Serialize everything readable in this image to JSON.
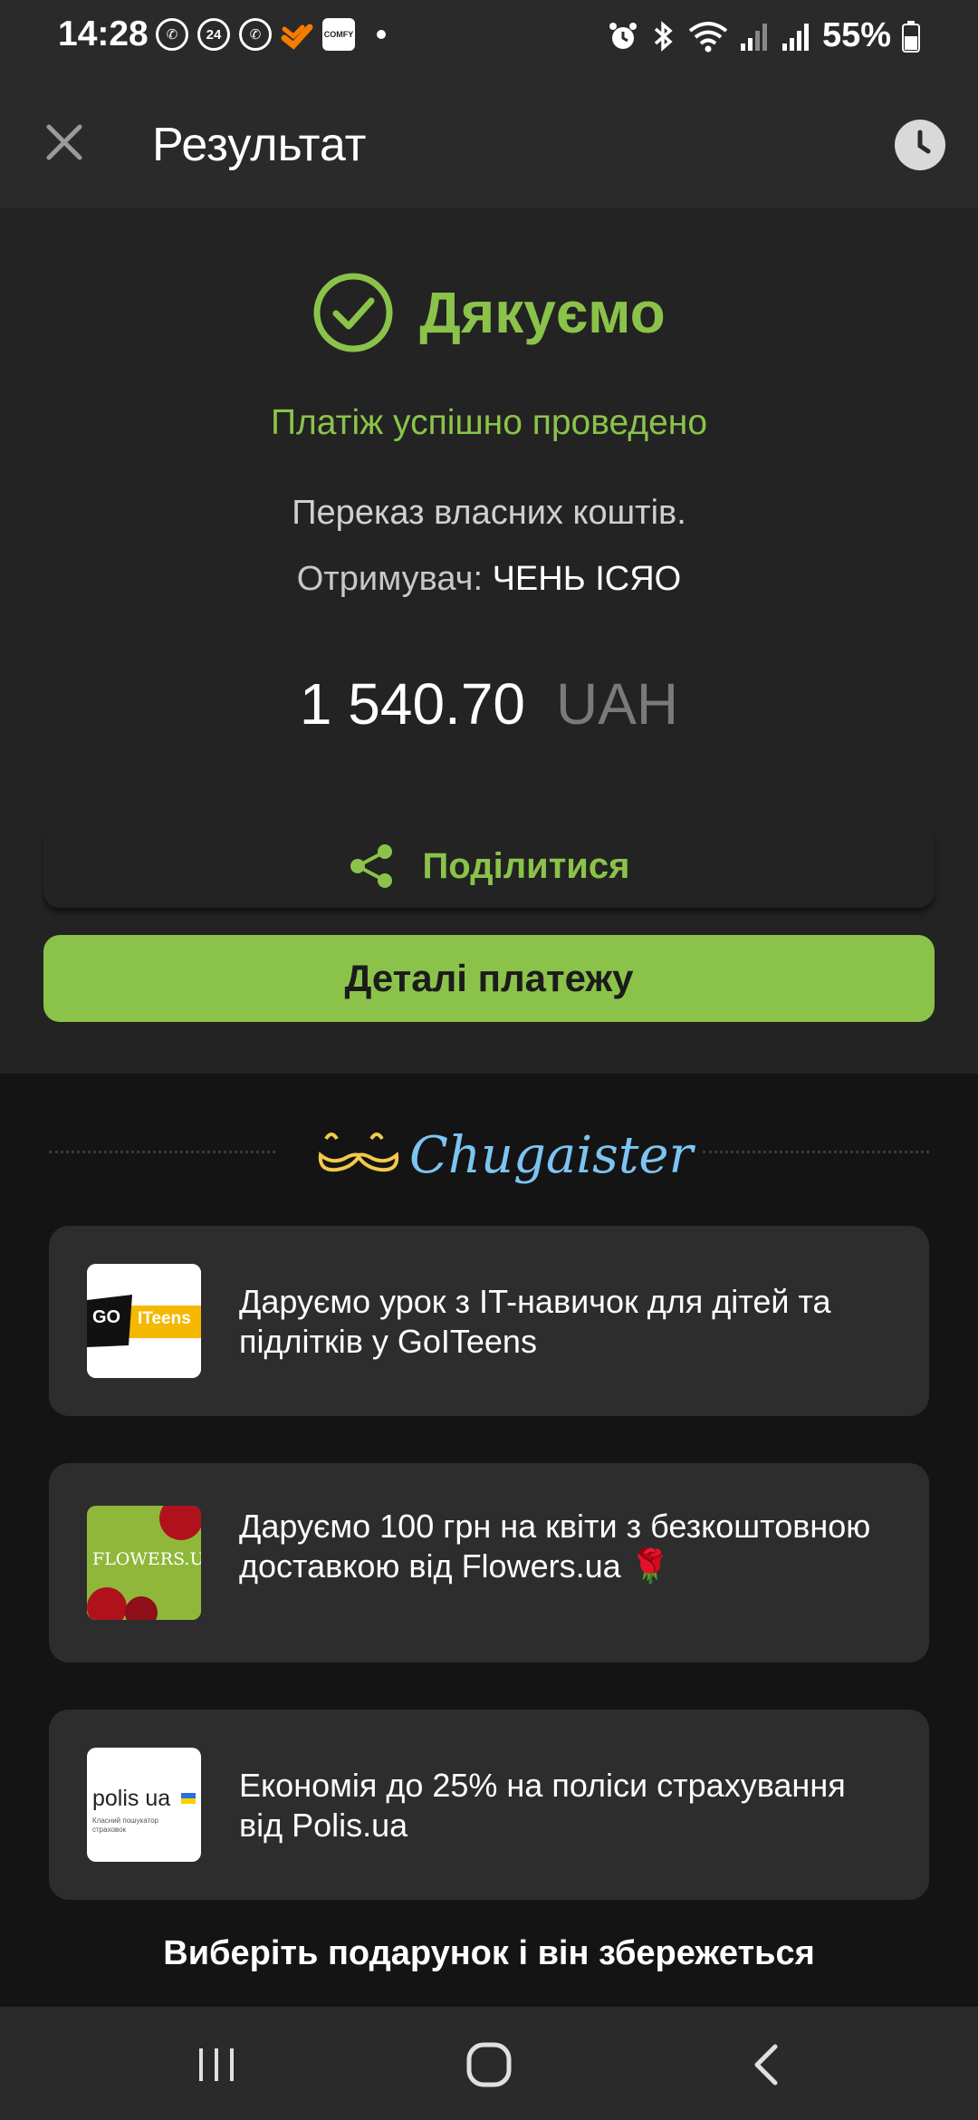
{
  "status_bar": {
    "time": "14:28",
    "left_icons": [
      "viber-icon",
      "notification-24-icon",
      "viber-icon",
      "app-icon",
      "comfy-icon"
    ],
    "comfy_label": "COMFY",
    "badge_24": "24",
    "battery": "55%"
  },
  "header": {
    "title": "Результат"
  },
  "result": {
    "thanks": "Дякуємо",
    "success": "Платіж успішно проведено",
    "transfer": "Переказ власних коштів.",
    "recipient_label": "Отримувач:",
    "recipient_name": "ЧЕНЬ ІСЯО",
    "amount": "1 540.70",
    "currency": "UAH",
    "share_label": "Поділитися",
    "details_label": "Деталі платежу"
  },
  "promos": {
    "brand": "Chugaister",
    "cards": [
      {
        "text": "Даруємо урок з IT-навичок для дітей та підлітків у GoITeens",
        "logo_a": "GO",
        "logo_b": "ITeens"
      },
      {
        "text": "Даруємо 100 грн на квіти з безкоштовною доставкою від Flowers.ua 🌹",
        "logo": "FLOWERS.UA"
      },
      {
        "text": "Економія до 25% на поліси страхування від Polis.ua",
        "logo": "polis ua",
        "logo_sub": "Класний пошукатор страховок"
      }
    ],
    "gift_note": "Виберіть подарунок і він збережеться"
  },
  "colors": {
    "accent": "#8bc34a",
    "brand_blue": "#7cc4f2",
    "background": "#161616",
    "card": "#2d2d2d"
  }
}
